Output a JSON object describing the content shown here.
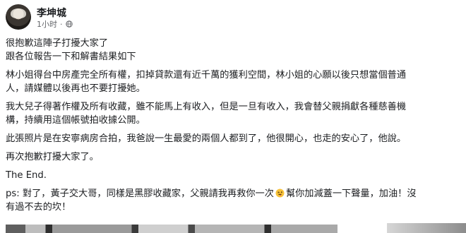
{
  "post": {
    "author": "李坤城",
    "timestamp": "1小时",
    "separator": "·",
    "lines": [
      [
        "很抱歉這陣子打擾大家了"
      ],
      [
        "跟各位報告一下和解書結果如下"
      ],
      [
        "林小姐得台中房產完全所有權，扣掉貸款還有近千萬的獲利空間，林小姐的心願以後只想當個普通"
      ],
      [
        "人，請媒體以後再也不要打擾她。"
      ],
      [
        "我大兒子得著作權及所有收藏，雖不能馬上有收入，但是一旦有收入，我會替父親捐獻各種慈善機"
      ],
      [
        "構，持續用這個帳號拍收據公開。"
      ],
      [
        "此張照片是在安寧病房合拍，我爸說一生最愛的兩個人都到了，他很開心，也走的安心了，他說。"
      ],
      [
        "再次抱歉打擾大家了。"
      ],
      [
        "The End."
      ],
      [
        "ps: 對了，黃子交大哥，同樣是黑膠收藏家，父親請我再救你一次",
        "幫你加減蓋一下聲量，加油！沒"
      ],
      [
        "有過不去的坎！"
      ]
    ]
  },
  "icons": {
    "audience": "globe-icon",
    "emoji": "grinning-tongue-emoji-icon"
  },
  "colors": {
    "text": "#1c1e21",
    "meta": "#65676b",
    "emoji": "#f7c23a"
  }
}
